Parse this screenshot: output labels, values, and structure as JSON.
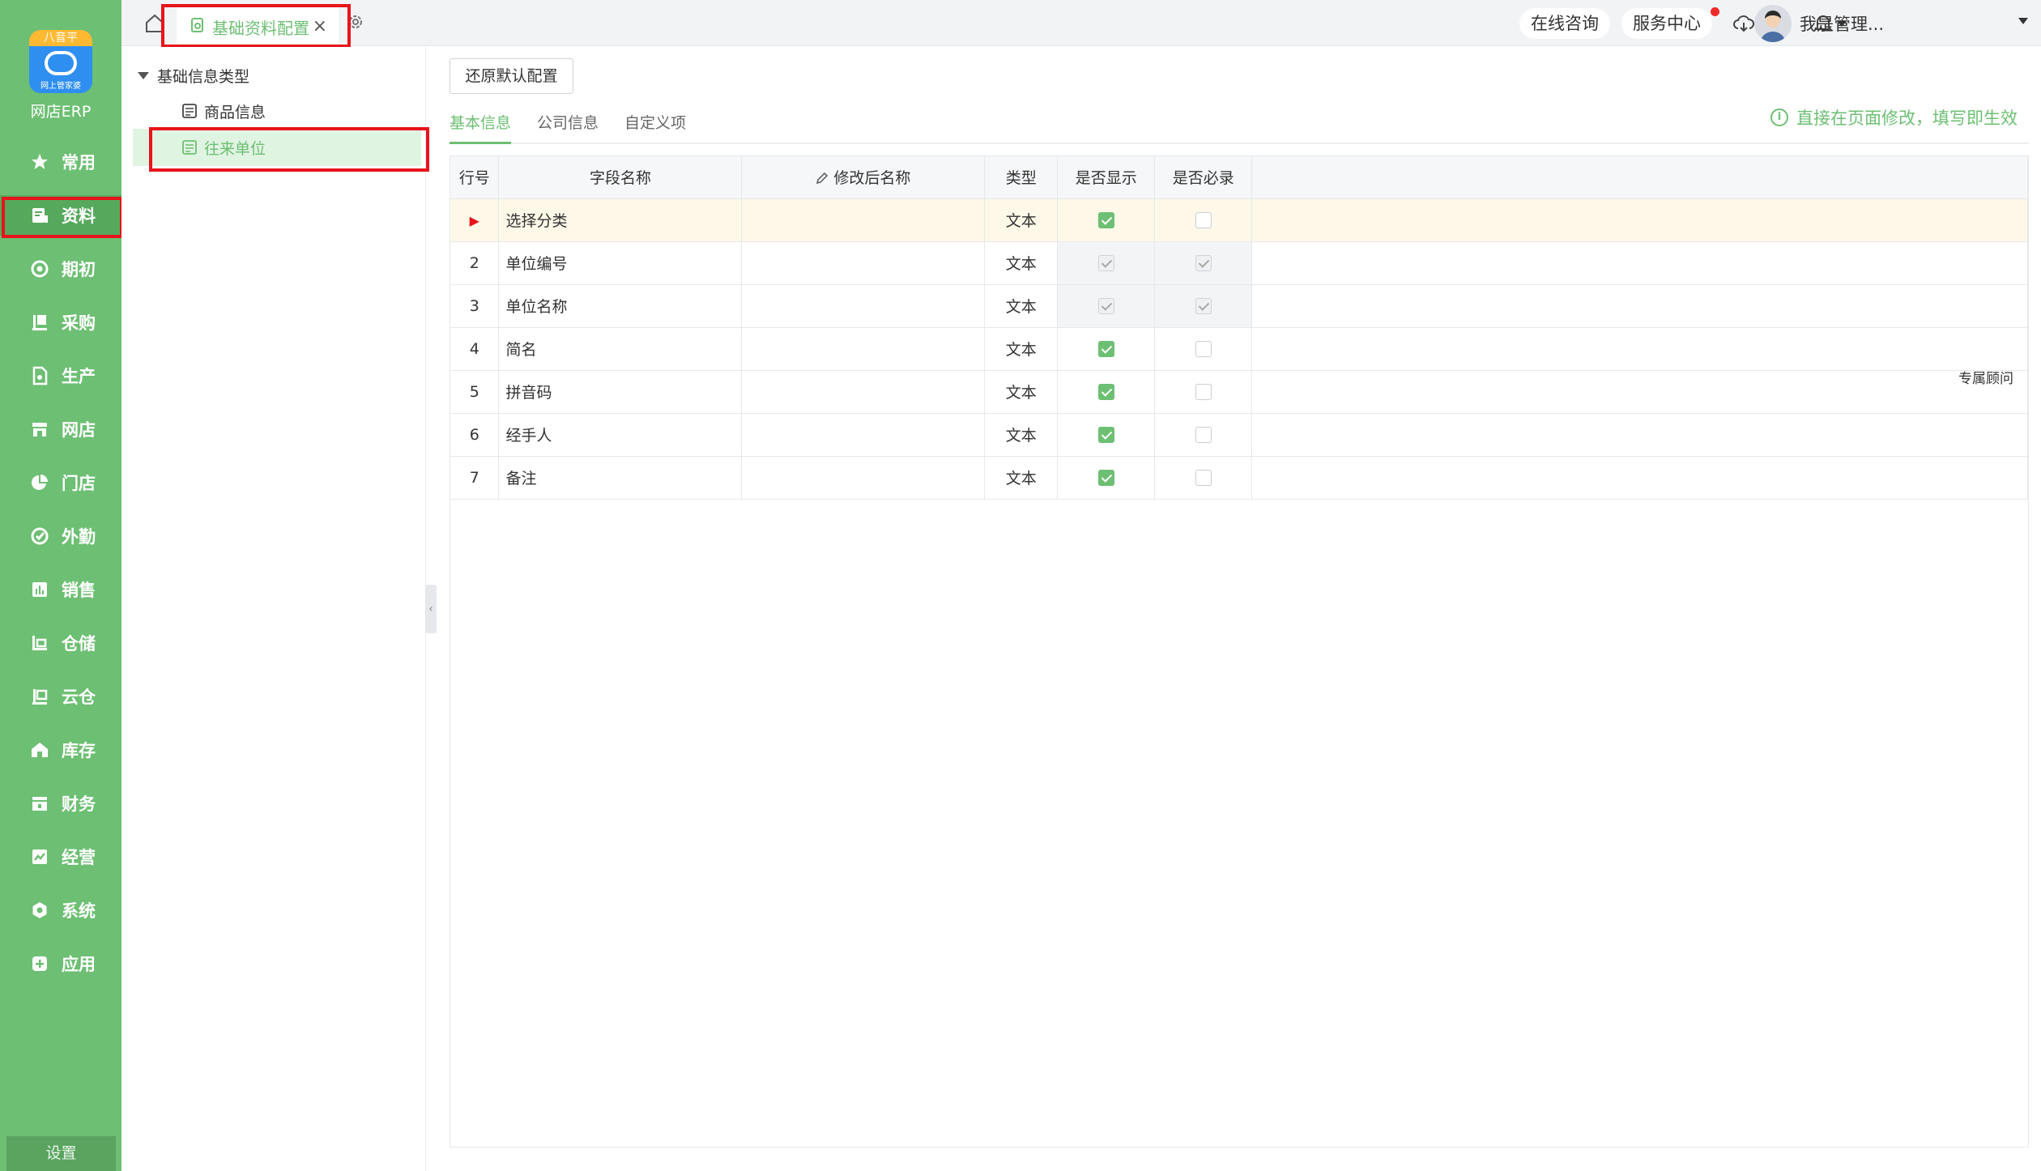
{
  "app": {
    "logo_top": "八音平",
    "logo_sub": "网上管家婆",
    "name": "网店ERP"
  },
  "sidebar": {
    "items": [
      {
        "label": "常用",
        "icon": "star-icon"
      },
      {
        "label": "资料",
        "icon": "document-icon",
        "active": true
      },
      {
        "label": "期初",
        "icon": "target-icon"
      },
      {
        "label": "采购",
        "icon": "purchase-icon"
      },
      {
        "label": "生产",
        "icon": "production-icon"
      },
      {
        "label": "网店",
        "icon": "store-icon"
      },
      {
        "label": "门店",
        "icon": "pie-chart-icon"
      },
      {
        "label": "外勤",
        "icon": "field-icon"
      },
      {
        "label": "销售",
        "icon": "bar-chart-icon"
      },
      {
        "label": "仓储",
        "icon": "warehouse-icon"
      },
      {
        "label": "云仓",
        "icon": "cloud-warehouse-icon"
      },
      {
        "label": "库存",
        "icon": "inventory-icon"
      },
      {
        "label": "财务",
        "icon": "finance-icon"
      },
      {
        "label": "经营",
        "icon": "business-icon"
      },
      {
        "label": "系统",
        "icon": "system-gear-icon"
      },
      {
        "label": "应用",
        "icon": "plus-icon"
      }
    ],
    "settings_label": "设置"
  },
  "topbar": {
    "tab_label": "基础资料配置",
    "tab_close": "×",
    "online_consult": "在线咨询",
    "service_center": "服务中心",
    "user_name": "我是管理..."
  },
  "tree": {
    "root": "基础信息类型",
    "nodes": [
      "商品信息",
      "往来单位"
    ],
    "selected": "往来单位"
  },
  "content": {
    "restore_button": "还原默认配置",
    "tabs": [
      "基本信息",
      "公司信息",
      "自定义项"
    ],
    "active_tab": "基本信息",
    "hint": "直接在页面修改，填写即生效",
    "advisor": "专属顾问",
    "columns": [
      "行号",
      "字段名称",
      "修改后名称",
      "类型",
      "是否显示",
      "是否必录"
    ],
    "rows": [
      {
        "no": "",
        "name": "选择分类",
        "renamed": "",
        "type": "文本",
        "show": true,
        "required": false,
        "show_disabled": false,
        "required_disabled": false
      },
      {
        "no": "2",
        "name": "单位编号",
        "renamed": "",
        "type": "文本",
        "show": true,
        "required": true,
        "show_disabled": true,
        "required_disabled": true
      },
      {
        "no": "3",
        "name": "单位名称",
        "renamed": "",
        "type": "文本",
        "show": true,
        "required": true,
        "show_disabled": true,
        "required_disabled": true
      },
      {
        "no": "4",
        "name": "简名",
        "renamed": "",
        "type": "文本",
        "show": true,
        "required": false,
        "show_disabled": false,
        "required_disabled": false
      },
      {
        "no": "5",
        "name": "拼音码",
        "renamed": "",
        "type": "文本",
        "show": true,
        "required": false,
        "show_disabled": false,
        "required_disabled": false
      },
      {
        "no": "6",
        "name": "经手人",
        "renamed": "",
        "type": "文本",
        "show": true,
        "required": false,
        "show_disabled": false,
        "required_disabled": false
      },
      {
        "no": "7",
        "name": "备注",
        "renamed": "",
        "type": "文本",
        "show": true,
        "required": false,
        "show_disabled": false,
        "required_disabled": false
      }
    ]
  },
  "colors": {
    "brand_green": "#6dbf73",
    "highlight_red": "#e8141b"
  }
}
